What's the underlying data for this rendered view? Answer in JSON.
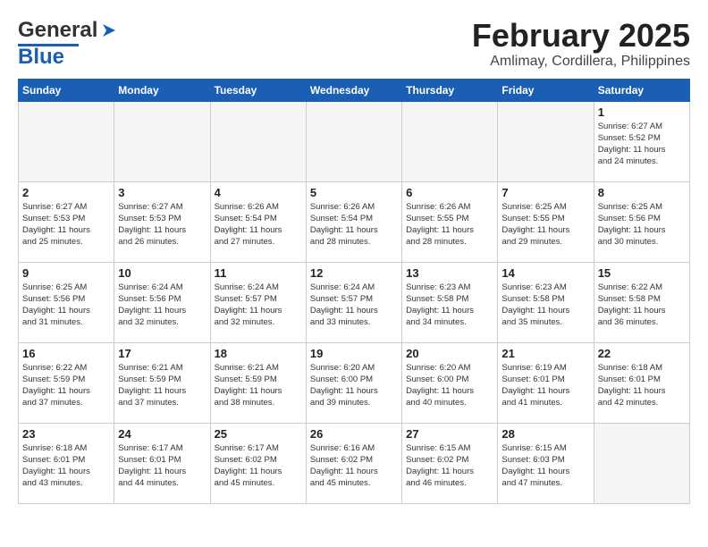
{
  "header": {
    "logo_general": "General",
    "logo_blue": "Blue",
    "month": "February 2025",
    "location": "Amlimay, Cordillera, Philippines"
  },
  "weekdays": [
    "Sunday",
    "Monday",
    "Tuesday",
    "Wednesday",
    "Thursday",
    "Friday",
    "Saturday"
  ],
  "weeks": [
    [
      {
        "day": "",
        "info": ""
      },
      {
        "day": "",
        "info": ""
      },
      {
        "day": "",
        "info": ""
      },
      {
        "day": "",
        "info": ""
      },
      {
        "day": "",
        "info": ""
      },
      {
        "day": "",
        "info": ""
      },
      {
        "day": "1",
        "info": "Sunrise: 6:27 AM\nSunset: 5:52 PM\nDaylight: 11 hours\nand 24 minutes."
      }
    ],
    [
      {
        "day": "2",
        "info": "Sunrise: 6:27 AM\nSunset: 5:53 PM\nDaylight: 11 hours\nand 25 minutes."
      },
      {
        "day": "3",
        "info": "Sunrise: 6:27 AM\nSunset: 5:53 PM\nDaylight: 11 hours\nand 26 minutes."
      },
      {
        "day": "4",
        "info": "Sunrise: 6:26 AM\nSunset: 5:54 PM\nDaylight: 11 hours\nand 27 minutes."
      },
      {
        "day": "5",
        "info": "Sunrise: 6:26 AM\nSunset: 5:54 PM\nDaylight: 11 hours\nand 28 minutes."
      },
      {
        "day": "6",
        "info": "Sunrise: 6:26 AM\nSunset: 5:55 PM\nDaylight: 11 hours\nand 28 minutes."
      },
      {
        "day": "7",
        "info": "Sunrise: 6:25 AM\nSunset: 5:55 PM\nDaylight: 11 hours\nand 29 minutes."
      },
      {
        "day": "8",
        "info": "Sunrise: 6:25 AM\nSunset: 5:56 PM\nDaylight: 11 hours\nand 30 minutes."
      }
    ],
    [
      {
        "day": "9",
        "info": "Sunrise: 6:25 AM\nSunset: 5:56 PM\nDaylight: 11 hours\nand 31 minutes."
      },
      {
        "day": "10",
        "info": "Sunrise: 6:24 AM\nSunset: 5:56 PM\nDaylight: 11 hours\nand 32 minutes."
      },
      {
        "day": "11",
        "info": "Sunrise: 6:24 AM\nSunset: 5:57 PM\nDaylight: 11 hours\nand 32 minutes."
      },
      {
        "day": "12",
        "info": "Sunrise: 6:24 AM\nSunset: 5:57 PM\nDaylight: 11 hours\nand 33 minutes."
      },
      {
        "day": "13",
        "info": "Sunrise: 6:23 AM\nSunset: 5:58 PM\nDaylight: 11 hours\nand 34 minutes."
      },
      {
        "day": "14",
        "info": "Sunrise: 6:23 AM\nSunset: 5:58 PM\nDaylight: 11 hours\nand 35 minutes."
      },
      {
        "day": "15",
        "info": "Sunrise: 6:22 AM\nSunset: 5:58 PM\nDaylight: 11 hours\nand 36 minutes."
      }
    ],
    [
      {
        "day": "16",
        "info": "Sunrise: 6:22 AM\nSunset: 5:59 PM\nDaylight: 11 hours\nand 37 minutes."
      },
      {
        "day": "17",
        "info": "Sunrise: 6:21 AM\nSunset: 5:59 PM\nDaylight: 11 hours\nand 37 minutes."
      },
      {
        "day": "18",
        "info": "Sunrise: 6:21 AM\nSunset: 5:59 PM\nDaylight: 11 hours\nand 38 minutes."
      },
      {
        "day": "19",
        "info": "Sunrise: 6:20 AM\nSunset: 6:00 PM\nDaylight: 11 hours\nand 39 minutes."
      },
      {
        "day": "20",
        "info": "Sunrise: 6:20 AM\nSunset: 6:00 PM\nDaylight: 11 hours\nand 40 minutes."
      },
      {
        "day": "21",
        "info": "Sunrise: 6:19 AM\nSunset: 6:01 PM\nDaylight: 11 hours\nand 41 minutes."
      },
      {
        "day": "22",
        "info": "Sunrise: 6:18 AM\nSunset: 6:01 PM\nDaylight: 11 hours\nand 42 minutes."
      }
    ],
    [
      {
        "day": "23",
        "info": "Sunrise: 6:18 AM\nSunset: 6:01 PM\nDaylight: 11 hours\nand 43 minutes."
      },
      {
        "day": "24",
        "info": "Sunrise: 6:17 AM\nSunset: 6:01 PM\nDaylight: 11 hours\nand 44 minutes."
      },
      {
        "day": "25",
        "info": "Sunrise: 6:17 AM\nSunset: 6:02 PM\nDaylight: 11 hours\nand 45 minutes."
      },
      {
        "day": "26",
        "info": "Sunrise: 6:16 AM\nSunset: 6:02 PM\nDaylight: 11 hours\nand 45 minutes."
      },
      {
        "day": "27",
        "info": "Sunrise: 6:15 AM\nSunset: 6:02 PM\nDaylight: 11 hours\nand 46 minutes."
      },
      {
        "day": "28",
        "info": "Sunrise: 6:15 AM\nSunset: 6:03 PM\nDaylight: 11 hours\nand 47 minutes."
      },
      {
        "day": "",
        "info": ""
      }
    ]
  ]
}
